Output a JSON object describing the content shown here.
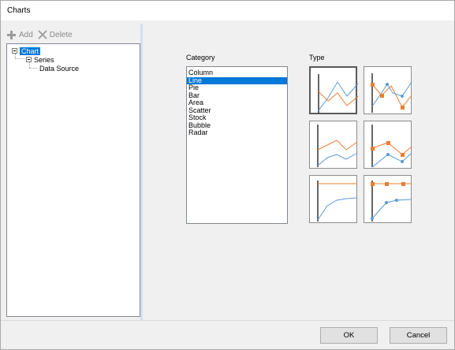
{
  "window": {
    "title": "Charts"
  },
  "toolbar": {
    "add_label": "Add",
    "delete_label": "Delete"
  },
  "tree": {
    "chart_label": "Chart",
    "series_label": "Series",
    "data_source_label": "Data Source"
  },
  "category": {
    "label": "Category",
    "items": [
      "Column",
      "Line",
      "Pie",
      "Bar",
      "Area",
      "Scatter",
      "Stock",
      "Bubble",
      "Radar"
    ],
    "selected": "Line"
  },
  "type": {
    "label": "Type",
    "selected_index": 0
  },
  "colors": {
    "selection": "#0078d7",
    "series_orange": "#ed7d31",
    "series_blue": "#5b9bd5"
  },
  "buttons": {
    "ok_label": "OK",
    "cancel_label": "Cancel"
  }
}
